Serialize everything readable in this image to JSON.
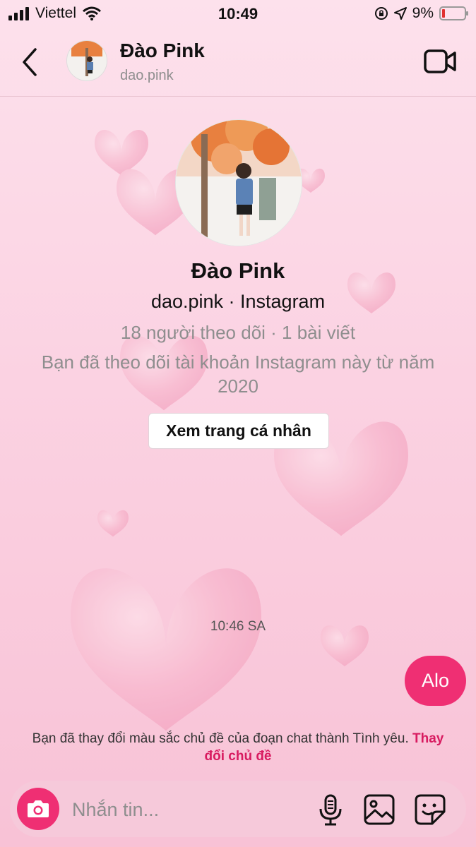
{
  "status_bar": {
    "carrier": "Viettel",
    "time": "10:49",
    "battery": "9%",
    "icons": [
      "signal-icon",
      "wifi-icon",
      "orientation-lock-icon",
      "location-icon",
      "battery-icon"
    ]
  },
  "header": {
    "name": "Đào Pink",
    "username": "dao.pink",
    "icons": [
      "back-icon",
      "video-call-icon"
    ]
  },
  "profile": {
    "name": "Đào Pink",
    "subtitle": "dao.pink · Instagram",
    "stats": "18 người theo dõi · 1 bài viết",
    "follow_info": "Bạn đã theo dõi tài khoản Instagram này từ năm 2020",
    "view_profile_button": "Xem trang cá nhân"
  },
  "chat": {
    "timestamp": "10:46 SA",
    "messages": [
      {
        "from": "me",
        "text": "Alo"
      }
    ],
    "theme_note": "Bạn đã thay đổi màu sắc chủ đề của đoạn chat thành Tình yêu.",
    "theme_link": "Thay đổi chủ đề"
  },
  "composer": {
    "placeholder": "Nhắn tin...",
    "icons": [
      "camera-icon",
      "microphone-icon",
      "gallery-icon",
      "sticker-icon"
    ]
  },
  "colors": {
    "accent": "#ef2f73",
    "link": "#d81b60",
    "background_top": "#fde1ec",
    "background_bottom": "#f8c2d6"
  }
}
